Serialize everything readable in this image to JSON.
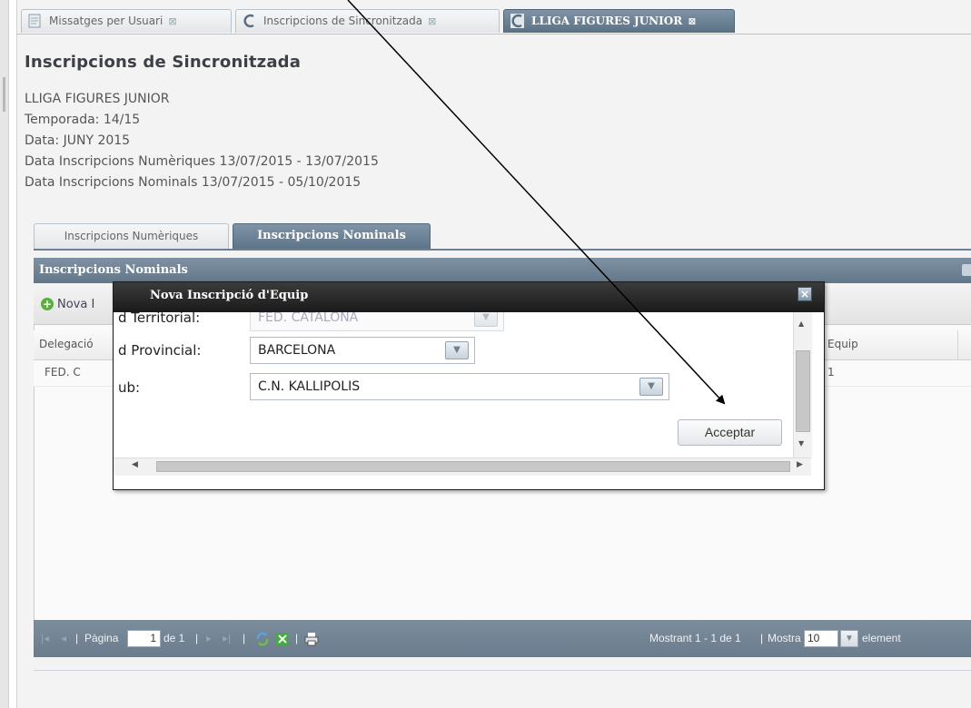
{
  "tabs": [
    {
      "label": "Missatges per Usuari",
      "close": "⊠"
    },
    {
      "label": "Inscripcions de Sincronitzada",
      "close": "⊠"
    },
    {
      "label": "LLIGA FIGURES JUNIOR",
      "close": "⊠"
    }
  ],
  "page": {
    "title": "Inscripcions de Sincronitzada",
    "info": [
      "LLIGA FIGURES JUNIOR",
      "Temporada: 14/15",
      "Data: JUNY 2015",
      "Data Inscripcions Numèriques 13/07/2015 - 13/07/2015",
      "Data Inscripcions Nominals 13/07/2015 - 05/10/2015"
    ]
  },
  "subtabs": {
    "numeriques": "Inscripcions Numèriques",
    "nominals": "Inscripcions Nominals"
  },
  "panel": {
    "title": "Inscripcions Nominals",
    "add_label": "Nova I",
    "columns": {
      "delegacio": "Delegació",
      "equip": "Equip"
    },
    "rows": [
      {
        "delegacio": "FED. C",
        "equip": "1"
      }
    ]
  },
  "pager": {
    "page_label": "Pàgina",
    "page_value": "1",
    "of_label": "de 1",
    "status": "Mostrant 1 - 1 de 1",
    "show_label": "Mostra",
    "show_value": "10",
    "elements_label": "element"
  },
  "dialog": {
    "title": "Nova Inscripció d'Equip",
    "fields": [
      {
        "label": "d Territorial:",
        "value": "FED. CATALONA"
      },
      {
        "label": "d Provincial:",
        "value": "BARCELONA"
      },
      {
        "label": "ub:",
        "value": "C.N. KALLIPOLIS"
      }
    ],
    "accept_label": "Acceptar"
  },
  "icons": {
    "tab1": "document-icon",
    "tab2": "c-logo-icon",
    "tab3": "c-logo-icon",
    "add": "plus-circle-icon",
    "close": "close-icon",
    "refresh": "refresh-icon",
    "export": "excel-icon",
    "print": "print-icon"
  },
  "colors": {
    "header": "#6b8093",
    "dialog_header": "#1f1f1f",
    "pager": "#74879a"
  }
}
